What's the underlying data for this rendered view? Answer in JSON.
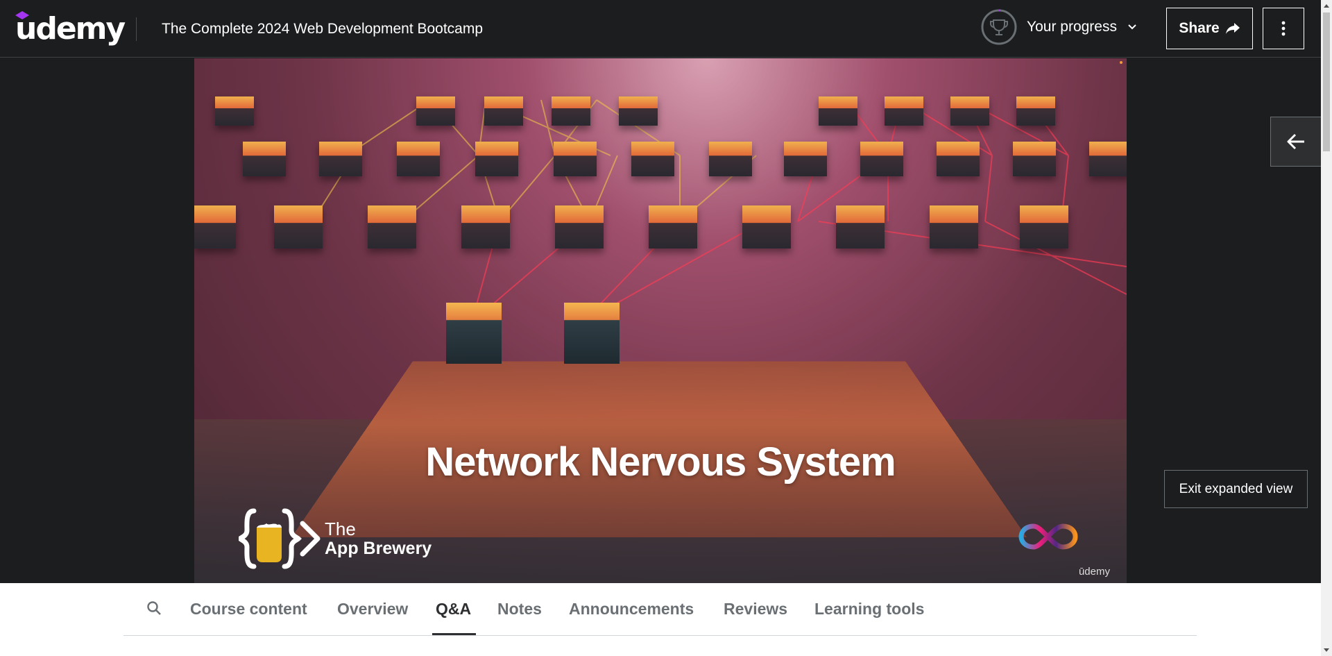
{
  "header": {
    "logo": "udemy",
    "course_title": "The Complete 2024 Web Development Bootcamp",
    "progress_label": "Your progress",
    "share_label": "Share",
    "more_icon": "vertical-dots-icon"
  },
  "video": {
    "slide_title": "Network Nervous System",
    "brand_the": "The",
    "brand_name": "App Brewery",
    "watermark": "ūdemy"
  },
  "side": {
    "back_icon": "arrow-left-icon",
    "exit_label": "Exit expanded view"
  },
  "tabs": {
    "items": [
      {
        "label": "Course content"
      },
      {
        "label": "Overview"
      },
      {
        "label": "Q&A",
        "active": true
      },
      {
        "label": "Notes"
      },
      {
        "label": "Announcements"
      },
      {
        "label": "Reviews"
      },
      {
        "label": "Learning tools"
      }
    ]
  },
  "colors": {
    "header_bg": "#1c1d1f",
    "brand_purple": "#a435f0",
    "tab_active": "#2d2f31",
    "tab_inactive": "#6a6f73"
  }
}
